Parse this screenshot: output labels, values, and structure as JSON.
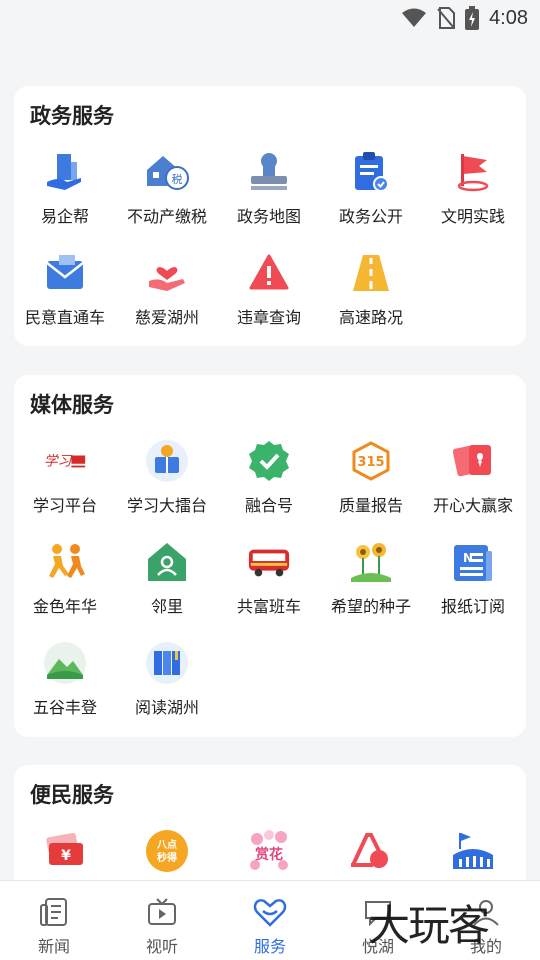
{
  "status": {
    "time": "4:08"
  },
  "sections": [
    {
      "title": "政务服务",
      "items": [
        {
          "label": "易企帮",
          "icon": "enterprise-icon"
        },
        {
          "label": "不动产缴税",
          "icon": "house-tax-icon"
        },
        {
          "label": "政务地图",
          "icon": "stamp-map-icon"
        },
        {
          "label": "政务公开",
          "icon": "clipboard-icon"
        },
        {
          "label": "文明实践",
          "icon": "flag-icon"
        },
        {
          "label": "民意直通车",
          "icon": "mail-icon"
        },
        {
          "label": "慈爱湖州",
          "icon": "heart-hand-icon"
        },
        {
          "label": "违章查询",
          "icon": "warning-icon"
        },
        {
          "label": "高速路况",
          "icon": "highway-icon"
        }
      ]
    },
    {
      "title": "媒体服务",
      "items": [
        {
          "label": "学习平台",
          "icon": "study-logo-icon"
        },
        {
          "label": "学习大擂台",
          "icon": "reader-icon"
        },
        {
          "label": "融合号",
          "icon": "check-badge-icon"
        },
        {
          "label": "质量报告",
          "icon": "315-icon"
        },
        {
          "label": "开心大赢家",
          "icon": "cards-icon"
        },
        {
          "label": "金色年华",
          "icon": "runners-icon"
        },
        {
          "label": "邻里",
          "icon": "neighbor-house-icon"
        },
        {
          "label": "共富班车",
          "icon": "bus-icon"
        },
        {
          "label": "希望的种子",
          "icon": "sunflower-icon"
        },
        {
          "label": "报纸订阅",
          "icon": "newspaper-icon"
        },
        {
          "label": "五谷丰登",
          "icon": "mountain-icon"
        },
        {
          "label": "阅读湖州",
          "icon": "book-icon"
        }
      ]
    },
    {
      "title": "便民服务",
      "items": [
        {
          "label": "",
          "icon": "yuan-ticket-icon"
        },
        {
          "label": "",
          "icon": "flash-sale-icon"
        },
        {
          "label": "",
          "icon": "flower-icon"
        },
        {
          "label": "",
          "icon": "vacuum-icon"
        },
        {
          "label": "",
          "icon": "stadium-flag-icon"
        }
      ]
    }
  ],
  "tabs": [
    {
      "label": "新闻",
      "icon": "news-icon"
    },
    {
      "label": "视听",
      "icon": "tv-icon"
    },
    {
      "label": "服务",
      "icon": "service-heart-icon"
    },
    {
      "label": "悦湖",
      "icon": "chat-icon"
    },
    {
      "label": "我的",
      "icon": "user-icon"
    }
  ],
  "active_tab": "服务",
  "watermark": "大玩客",
  "colors": {
    "accent": "#2f6de0",
    "red": "#f04b55",
    "orange": "#f5a623",
    "green": "#3bb36a"
  }
}
